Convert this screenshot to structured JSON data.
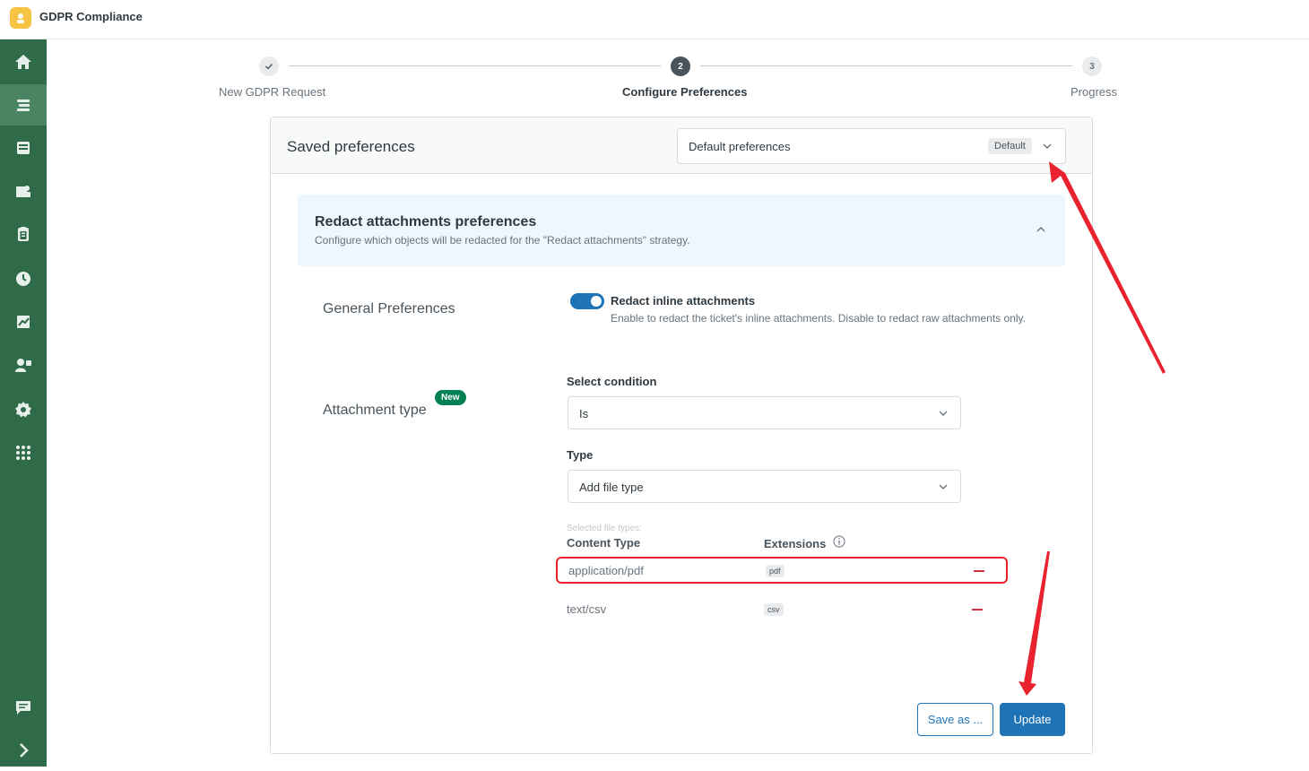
{
  "app": {
    "title": "GDPR Compliance"
  },
  "sidebar": {
    "items": [
      {
        "icon": "home-icon"
      },
      {
        "icon": "requests-icon",
        "active": true
      },
      {
        "icon": "inbox-icon"
      },
      {
        "icon": "contacts-icon"
      },
      {
        "icon": "clipboard-icon"
      },
      {
        "icon": "clock-icon"
      },
      {
        "icon": "reports-icon"
      },
      {
        "icon": "users-icon"
      },
      {
        "icon": "gear-icon"
      },
      {
        "icon": "apps-icon"
      }
    ],
    "bottom": [
      {
        "icon": "chat-icon"
      },
      {
        "icon": "expand-icon"
      }
    ]
  },
  "stepper": {
    "steps": [
      {
        "number": "✓",
        "label": "New GDPR Request",
        "state": "done"
      },
      {
        "number": "2",
        "label": "Configure Preferences",
        "state": "current"
      },
      {
        "number": "3",
        "label": "Progress",
        "state": "todo"
      }
    ]
  },
  "saved": {
    "title": "Saved preferences",
    "selected": "Default preferences",
    "badge": "Default"
  },
  "section": {
    "title": "Redact attachments preferences",
    "subtitle": "Configure which objects will be redacted for the \"Redact attachments\" strategy."
  },
  "general": {
    "label": "General Preferences",
    "toggle_on": true,
    "toggle_title": "Redact inline attachments",
    "toggle_desc": "Enable to redact the ticket's inline attachments. Disable to redact raw attachments only."
  },
  "attachment": {
    "label": "Attachment type",
    "new_badge": "New",
    "condition_label": "Select condition",
    "condition_value": "Is",
    "type_label": "Type",
    "type_placeholder": "Add file type",
    "selected_hint": "Selected file types:",
    "col_content": "Content Type",
    "col_ext": "Extensions",
    "rows": [
      {
        "content_type": "application/pdf",
        "extension": "pdf"
      },
      {
        "content_type": "text/csv",
        "extension": "csv"
      }
    ]
  },
  "actions": {
    "save_as": "Save as ...",
    "update": "Update"
  },
  "colors": {
    "sidebar": "#2f6a49",
    "primary": "#1f73b7",
    "highlight": "#e8232e",
    "new_badge": "#038153"
  }
}
